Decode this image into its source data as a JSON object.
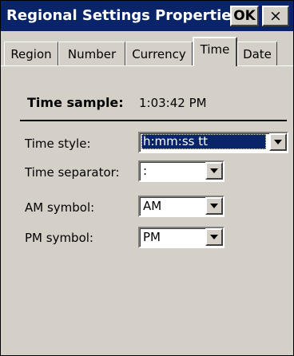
{
  "window": {
    "title": "Regional Settings Properties",
    "ok_label": "OK",
    "close_label": "×"
  },
  "tabs": [
    {
      "label": "Region",
      "active": false
    },
    {
      "label": "Number",
      "active": false
    },
    {
      "label": "Currency",
      "active": false
    },
    {
      "label": "Time",
      "active": true
    },
    {
      "label": "Date",
      "active": false
    }
  ],
  "time_sample": {
    "label": "Time sample:",
    "value": "1:03:42 PM"
  },
  "fields": {
    "time_style": {
      "label": "Time style:",
      "value": "h:mm:ss tt"
    },
    "time_separator": {
      "label": "Time separator:",
      "value": ":"
    },
    "am_symbol": {
      "label": "AM symbol:",
      "value": "AM"
    },
    "pm_symbol": {
      "label": "PM symbol:",
      "value": "PM"
    }
  },
  "colors": {
    "titlebar": "#0a246a",
    "face": "#d4d0c8",
    "selection": "#0a246a"
  }
}
